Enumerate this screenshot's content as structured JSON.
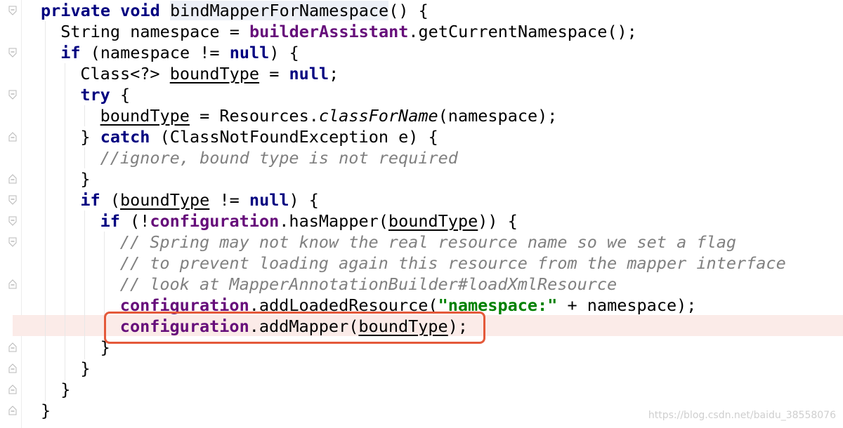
{
  "editor": {
    "lines": [
      {
        "tokens": [
          {
            "t": "private void ",
            "c": "kw"
          },
          {
            "t": "bindMapperForNamespace",
            "c": "method-hl"
          },
          {
            "t": "() {",
            "c": ""
          }
        ]
      },
      {
        "tokens": [
          {
            "t": "String namespace = ",
            "c": ""
          },
          {
            "t": "builderAssistant",
            "c": "fld"
          },
          {
            "t": ".getCurrentNamespace();",
            "c": ""
          }
        ]
      },
      {
        "tokens": [
          {
            "t": "if",
            "c": "kw"
          },
          {
            "t": " (namespace != ",
            "c": ""
          },
          {
            "t": "null",
            "c": "kw"
          },
          {
            "t": ") {",
            "c": ""
          }
        ]
      },
      {
        "tokens": [
          {
            "t": "Class<?> ",
            "c": ""
          },
          {
            "t": "boundType",
            "c": "var"
          },
          {
            "t": " = ",
            "c": ""
          },
          {
            "t": "null",
            "c": "kw"
          },
          {
            "t": ";",
            "c": ""
          }
        ]
      },
      {
        "tokens": [
          {
            "t": "try",
            "c": "kw"
          },
          {
            "t": " {",
            "c": ""
          }
        ]
      },
      {
        "tokens": [
          {
            "t": "boundType",
            "c": "var"
          },
          {
            "t": " = Resources.",
            "c": ""
          },
          {
            "t": "classForName",
            "c": "static"
          },
          {
            "t": "(namespace);",
            "c": ""
          }
        ]
      },
      {
        "tokens": [
          {
            "t": "} ",
            "c": ""
          },
          {
            "t": "catch",
            "c": "kw"
          },
          {
            "t": " (ClassNotFoundException e) {",
            "c": ""
          }
        ]
      },
      {
        "tokens": [
          {
            "t": "//ignore, bound type is not required",
            "c": "cmt"
          }
        ]
      },
      {
        "tokens": [
          {
            "t": "}",
            "c": ""
          }
        ]
      },
      {
        "tokens": [
          {
            "t": "if",
            "c": "kw"
          },
          {
            "t": " (",
            "c": ""
          },
          {
            "t": "boundType",
            "c": "var"
          },
          {
            "t": " != ",
            "c": ""
          },
          {
            "t": "null",
            "c": "kw"
          },
          {
            "t": ") {",
            "c": ""
          }
        ]
      },
      {
        "tokens": [
          {
            "t": "if",
            "c": "kw"
          },
          {
            "t": " (!",
            "c": ""
          },
          {
            "t": "configuration",
            "c": "fld"
          },
          {
            "t": ".hasMapper(",
            "c": ""
          },
          {
            "t": "boundType",
            "c": "var"
          },
          {
            "t": ")) {",
            "c": ""
          }
        ]
      },
      {
        "tokens": [
          {
            "t": "// Spring may not know the real resource name so we set a flag",
            "c": "cmt"
          }
        ]
      },
      {
        "tokens": [
          {
            "t": "// to prevent loading again this resource from the mapper interface",
            "c": "cmt"
          }
        ]
      },
      {
        "tokens": [
          {
            "t": "// look at MapperAnnotationBuilder#loadXmlResource",
            "c": "cmt"
          }
        ]
      },
      {
        "tokens": [
          {
            "t": "configuration",
            "c": "fld"
          },
          {
            "t": ".addLoadedResource(",
            "c": ""
          },
          {
            "t": "\"namespace:\"",
            "c": "str"
          },
          {
            "t": " + namespace);",
            "c": ""
          }
        ]
      },
      {
        "tokens": [
          {
            "t": "configuration",
            "c": "fld"
          },
          {
            "t": ".addMapper(",
            "c": ""
          },
          {
            "t": "boundType",
            "c": "var"
          },
          {
            "t": ");",
            "c": ""
          }
        ]
      },
      {
        "tokens": [
          {
            "t": "}",
            "c": ""
          }
        ]
      },
      {
        "tokens": [
          {
            "t": "}",
            "c": ""
          }
        ]
      },
      {
        "tokens": [
          {
            "t": "}",
            "c": ""
          }
        ]
      },
      {
        "tokens": [
          {
            "t": "}",
            "c": ""
          }
        ]
      }
    ],
    "highlighted_line": 16,
    "annotation_color": "#e4593a"
  },
  "watermark": "https://blog.csdn.net/baidu_38558076"
}
